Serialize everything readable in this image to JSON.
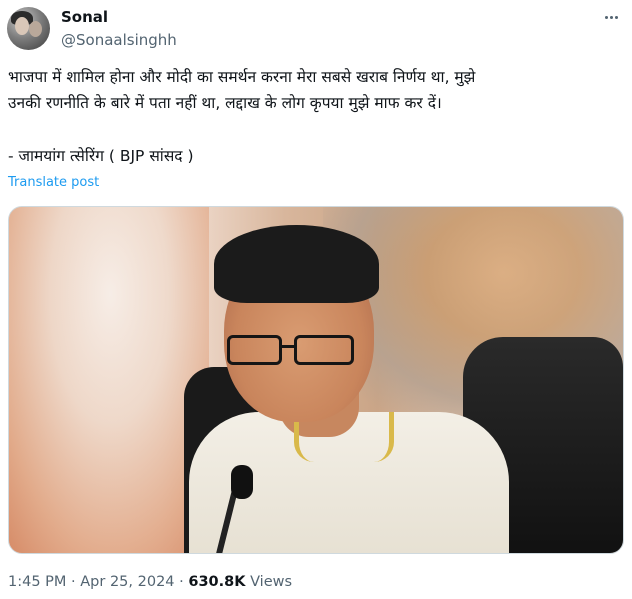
{
  "author": {
    "display_name": "Sonal",
    "handle": "@Sonaalsinghh"
  },
  "tweet": {
    "text": "भाजपा में शामिल होना और मोदी का समर्थन करना मेरा सबसे खराब निर्णय था, मुझे\nउनकी रणनीति के बारे में पता नहीं था, लद्दाख के लोग कृपया मुझे माफ कर दें।",
    "quote": "- जामयांग त्सेरिंग ( BJP सांसद )",
    "translate_label": "Translate post"
  },
  "meta": {
    "time": "1:45 PM",
    "date": "Apr 25, 2024",
    "views_count": "630.8K",
    "views_label": "Views",
    "separator": "·"
  },
  "icons": {
    "more": "more-options-icon"
  }
}
